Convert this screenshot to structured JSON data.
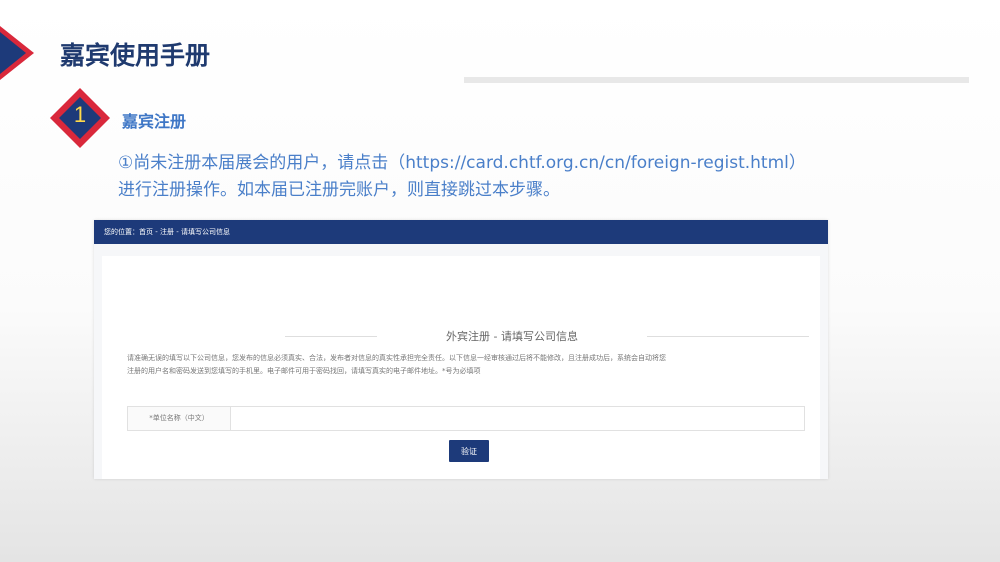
{
  "slide": {
    "title": "嘉宾使用手册"
  },
  "step": {
    "number": "1",
    "title": "嘉宾注册"
  },
  "instruction": {
    "line1": "①尚未注册本届展会的用户，请点击（https://card.chtf.org.cn/cn/foreign-regist.html）",
    "line2": "进行注册操作。如本届已注册完账户，则直接跳过本步骤。"
  },
  "screenshot": {
    "breadcrumb": "您的位置：首页 - 注册 - 请填写公司信息",
    "form_heading": "外宾注册 - 请填写公司信息",
    "notice_line1": "请准确无误的填写以下公司信息，您发布的信息必须真实、合法，发布者对信息的真实性承担完全责任。以下信息一经审核通过后将不能修改，且注册成功后，系统会自动将您",
    "notice_line2": "注册的用户名和密码发送到您填写的手机里。电子邮件可用于密码找回，请填写真实的电子邮件地址。*号为必填项",
    "company_name_label": "*单位名称（中文）",
    "company_name_value": "",
    "verify_button": "验证"
  },
  "colors": {
    "navy": "#1d3a7a",
    "title_blue": "#1f3a6f",
    "accent_red": "#d9283b",
    "text_blue": "#4a7fc9",
    "badge_number": "#ffd84a"
  }
}
